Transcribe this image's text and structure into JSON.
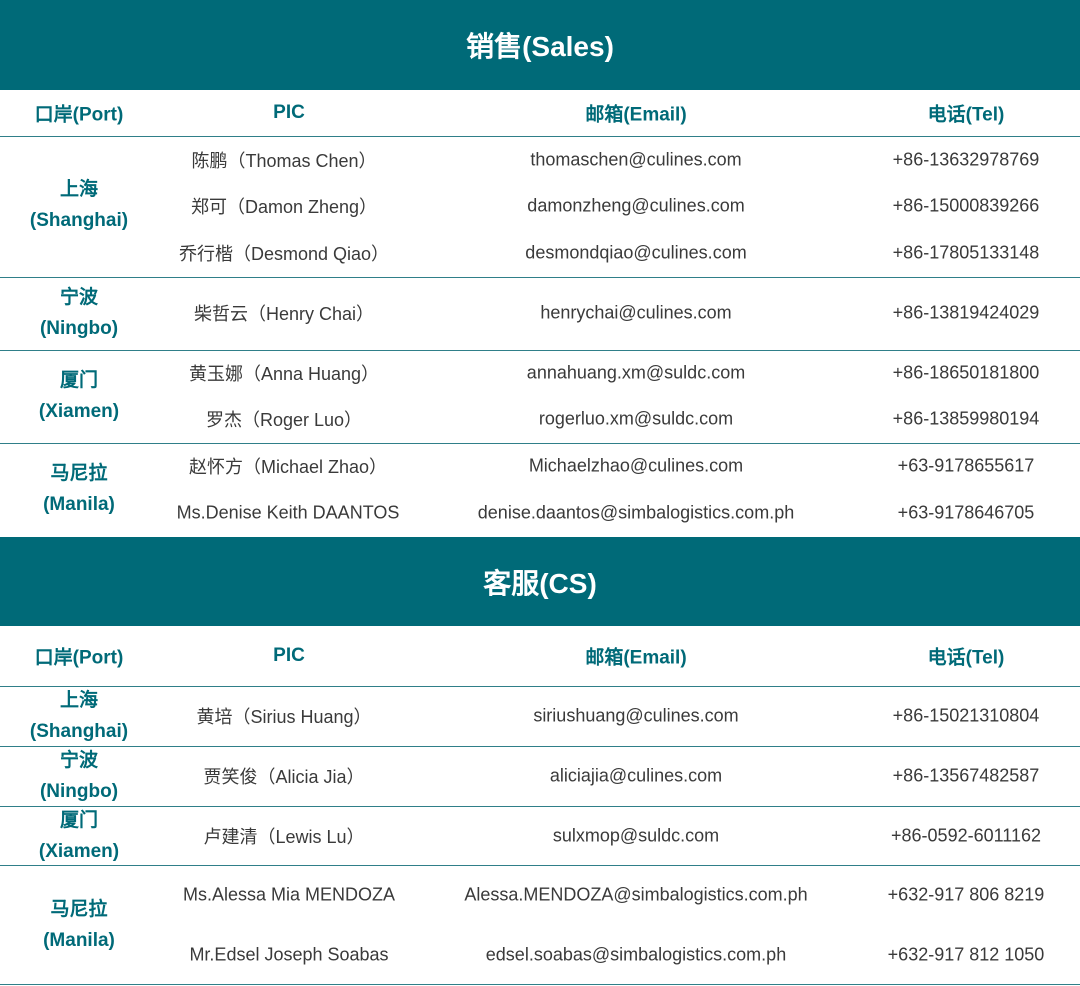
{
  "sections": [
    {
      "title": "销售(Sales)",
      "headers": {
        "port": "口岸(Port)",
        "pic": "PIC",
        "email": "邮箱(Email)",
        "tel": "电话(Tel)"
      },
      "groups": [
        {
          "port_cn": "上海",
          "port_en": "(Shanghai)",
          "rows": [
            {
              "pic": "陈鹏（Thomas Chen）",
              "email": "thomaschen@culines.com",
              "tel": "+86-13632978769"
            },
            {
              "pic": "郑可（Damon Zheng）",
              "email": "damonzheng@culines.com",
              "tel": "+86-15000839266"
            },
            {
              "pic": "乔行楷（Desmond Qiao）",
              "email": "desmondqiao@culines.com",
              "tel": "+86-17805133148"
            }
          ]
        },
        {
          "port_cn": "宁波",
          "port_en": "(Ningbo)",
          "rows": [
            {
              "pic": "柴哲云（Henry Chai）",
              "email": "henrychai@culines.com",
              "tel": "+86-13819424029"
            }
          ]
        },
        {
          "port_cn": "厦门",
          "port_en": "(Xiamen)",
          "rows": [
            {
              "pic": "黄玉娜（Anna Huang）",
              "email": "annahuang.xm@suldc.com",
              "tel": "+86-18650181800"
            },
            {
              "pic": "罗杰（Roger Luo）",
              "email": "rogerluo.xm@suldc.com",
              "tel": "+86-13859980194"
            }
          ]
        },
        {
          "port_cn": "马尼拉",
          "port_en": "(Manila)",
          "rows": [
            {
              "pic": "赵怀方（Michael Zhao）",
              "email": "Michaelzhao@culines.com",
              "tel": "+63-9178655617"
            },
            {
              "pic": "Ms.Denise Keith DAANTOS",
              "email": "denise.daantos@simbalogistics.com.ph",
              "tel": "+63-9178646705"
            }
          ]
        }
      ]
    },
    {
      "title": "客服(CS)",
      "headers": {
        "port": "口岸(Port)",
        "pic": "PIC",
        "email": "邮箱(Email)",
        "tel": "电话(Tel)"
      },
      "groups": [
        {
          "port_cn": "上海",
          "port_en": "(Shanghai)",
          "rows": [
            {
              "pic": "黄培（Sirius Huang）",
              "email": "siriushuang@culines.com",
              "tel": "+86-15021310804"
            }
          ]
        },
        {
          "port_cn": "宁波",
          "port_en": "(Ningbo)",
          "rows": [
            {
              "pic": "贾笑俊（Alicia Jia）",
              "email": "aliciajia@culines.com",
              "tel": "+86-13567482587"
            }
          ]
        },
        {
          "port_cn": "厦门",
          "port_en": "(Xiamen)",
          "rows": [
            {
              "pic": "卢建清（Lewis Lu）",
              "email": "sulxmop@suldc.com",
              "tel": "+86-0592-6011162"
            }
          ]
        },
        {
          "port_cn": "马尼拉",
          "port_en": "(Manila)",
          "rows": [
            {
              "pic": "Ms.Alessa Mia MENDOZA",
              "email": "Alessa.MENDOZA@simbalogistics.com.ph",
              "tel": "+632-917 806 8219"
            },
            {
              "pic": "Mr.Edsel Joseph Soabas",
              "email": "edsel.soabas@simbalogistics.com.ph",
              "tel": "+632-917 812 1050"
            }
          ]
        }
      ]
    }
  ]
}
